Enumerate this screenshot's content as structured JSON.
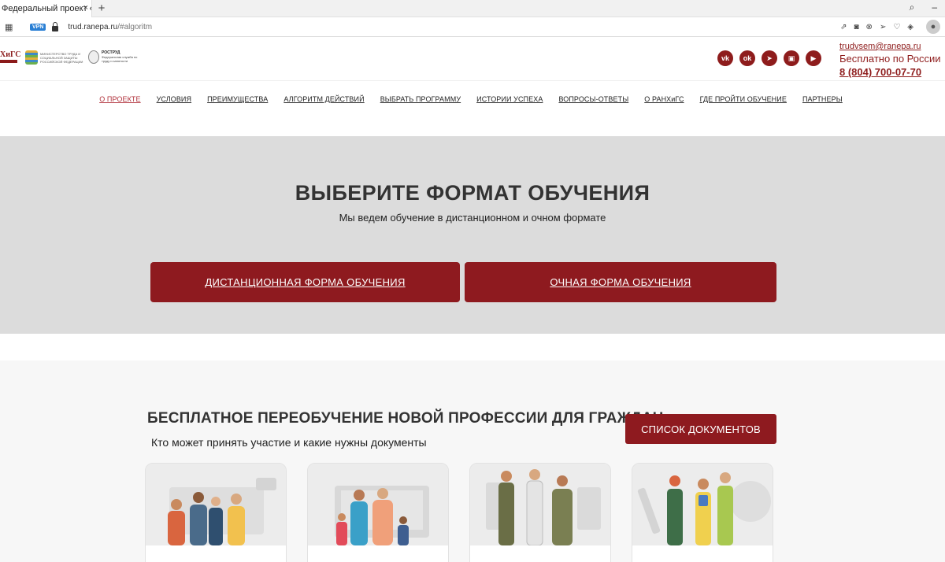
{
  "browser": {
    "tab_title": "Федеральный проект «Со",
    "tab_close": "×",
    "new_tab": "+",
    "url_host": "trud.ranepa.ru",
    "url_path": "/#algoritm",
    "vpn_label": "VPN",
    "icons": [
      "search-icon",
      "minimize-icon",
      "share-icon",
      "camera-icon",
      "block-icon",
      "send-icon",
      "heart-icon",
      "cube-icon",
      "profile-icon"
    ]
  },
  "header": {
    "logo_ranepa": "ХиГС",
    "logo_mintrud": "МИНИСТЕРСТВО ТРУДА И СОЦИАЛЬНОЙ ЗАЩИТЫ РОССИЙСКОЙ ФЕДЕРАЦИИ",
    "logo_rostrud_title": "РОСТРУД",
    "logo_rostrud_sub": "Федеральная служба по труду и занятости",
    "socials": [
      {
        "name": "vk-icon",
        "glyph": "vk"
      },
      {
        "name": "ok-icon",
        "glyph": "ok"
      },
      {
        "name": "telegram-icon",
        "glyph": "➤"
      },
      {
        "name": "rutube-icon",
        "glyph": "▣"
      },
      {
        "name": "youtube-icon",
        "glyph": "▶"
      }
    ],
    "email": "trudvsem@ranepa.ru",
    "free_label": "Бесплатно по России",
    "phone": "8 (804) 700-07-70"
  },
  "nav": {
    "items": [
      "О ПРОЕКТЕ",
      "УСЛОВИЯ",
      "ПРЕИМУЩЕСТВА",
      "АЛГОРИТМ ДЕЙСТВИЙ",
      "ВЫБРАТЬ ПРОГРАММУ",
      "ИСТОРИИ УСПЕХА",
      "ВОПРОСЫ-ОТВЕТЫ",
      "О РАНХиГС",
      "ГДЕ ПРОЙТИ ОБУЧЕНИЕ",
      "ПАРТНЕРЫ"
    ],
    "active_index": 0
  },
  "format": {
    "title": "ВЫБЕРИТЕ ФОРМАТ ОБУЧЕНИЯ",
    "subtitle": "Мы ведем обучение в дистанционном и очном формате",
    "remote_button": "ДИСТАНЦИОННАЯ ФОРМА ОБУЧЕНИЯ",
    "inperson_button": "ОЧНАЯ ФОРМА ОБУЧЕНИЯ"
  },
  "retrain": {
    "title": "БЕСПЛАТНОЕ ПЕРЕОБУЧЕНИЕ НОВОЙ ПРОФЕССИИ ДЛЯ ГРАЖДАН",
    "subtitle": "Кто может принять участие и какие нужны документы",
    "docs_button": "СПИСОК ДОКУМЕНТОВ"
  },
  "colors": {
    "brand": "#8e1a1f",
    "section_gray": "#dcdcdc",
    "active_nav": "#b0303a"
  }
}
